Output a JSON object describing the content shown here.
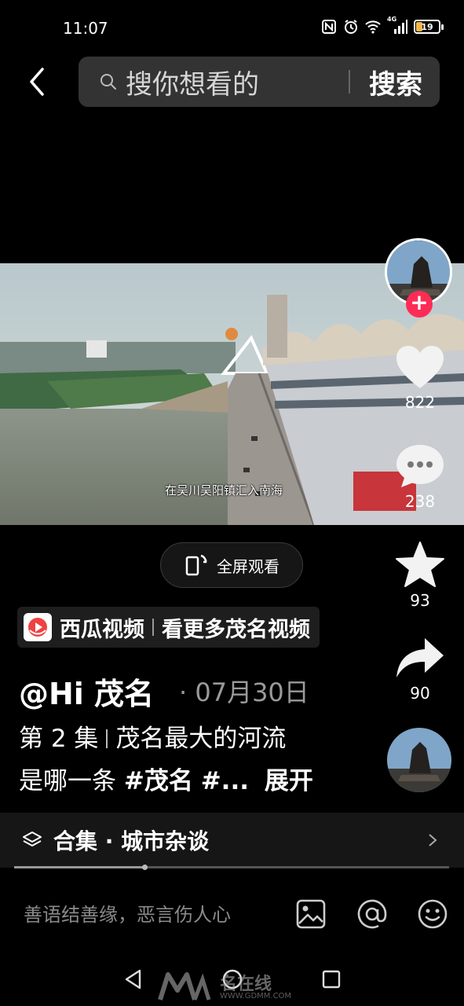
{
  "status_bar": {
    "time": "11:07",
    "battery": "19",
    "network": "4G"
  },
  "search": {
    "placeholder": "搜你想看的",
    "submit": "搜索"
  },
  "video": {
    "subtitle": "在吴川吴阳镇汇入南海"
  },
  "rail": {
    "likes": "822",
    "comments": "238",
    "favorites": "93",
    "shares": "90"
  },
  "fullscreen": {
    "label": "全屏观看"
  },
  "source": {
    "name": "西瓜视频",
    "more": "看更多茂名视频"
  },
  "post": {
    "author": "@Hi 茂名",
    "date": "07月30日",
    "episode": "第 2 集",
    "title_part": "茂名最大的河流",
    "line2_text": "是哪一条",
    "tag": "#茂名",
    "tag_more": "#...",
    "expand": "展开"
  },
  "collection": {
    "label": "合集 · 城市杂谈"
  },
  "progress": {
    "played_fraction": 0.3
  },
  "comment": {
    "placeholder": "善语结善缘，恶言伤人心"
  },
  "watermark": {
    "text": "名在线",
    "url": "WWW.GDMM.COM"
  },
  "colors": {
    "accent": "#fe2c55",
    "background": "#000000",
    "battery": "#f0b94d"
  }
}
